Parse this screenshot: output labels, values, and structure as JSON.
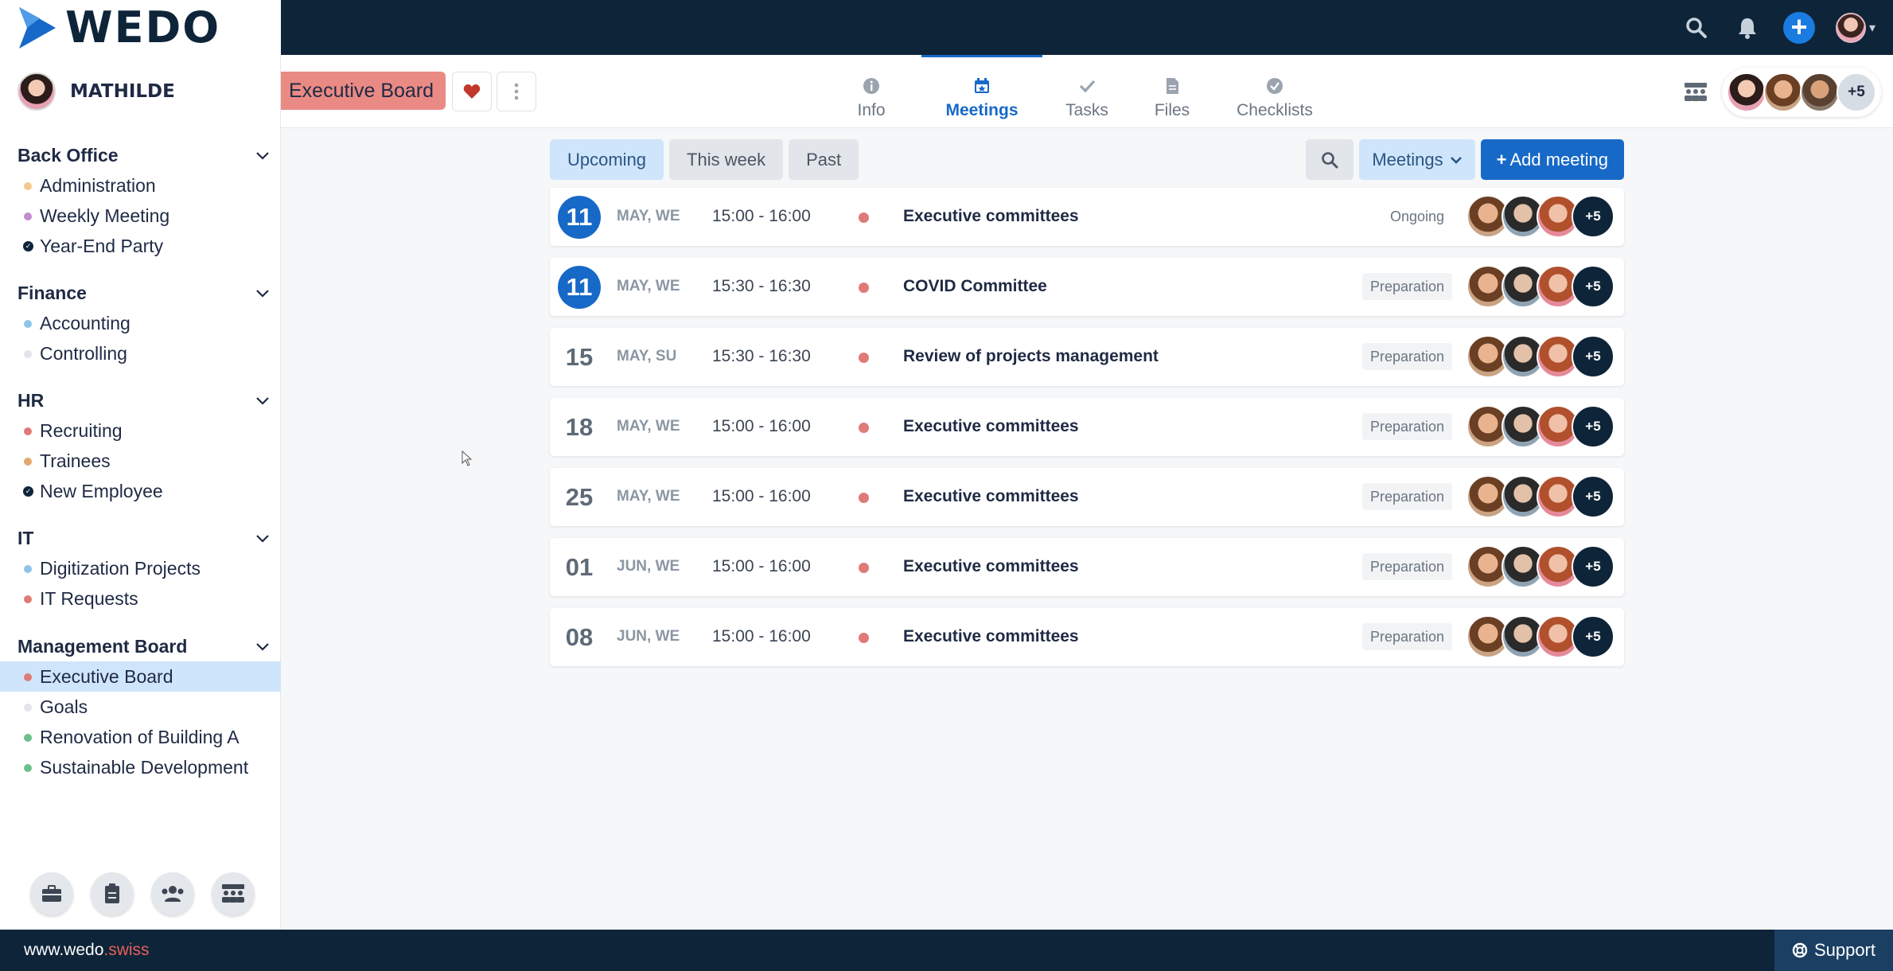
{
  "brand": {
    "name": "WEDO"
  },
  "user": {
    "name": "MATHILDE"
  },
  "sidebar": {
    "groups": [
      {
        "title": "Back Office",
        "items": [
          {
            "label": "Administration",
            "color": "#f3c98b",
            "marker": "dot"
          },
          {
            "label": "Weekly Meeting",
            "color": "#c48ccf",
            "marker": "dot"
          },
          {
            "label": "Year-End Party",
            "color": "#0e2439",
            "marker": "check"
          }
        ]
      },
      {
        "title": "Finance",
        "items": [
          {
            "label": "Accounting",
            "color": "#8ec4ea",
            "marker": "dot"
          },
          {
            "label": "Controlling",
            "color": "#e2e5e9",
            "marker": "dot"
          }
        ]
      },
      {
        "title": "HR",
        "items": [
          {
            "label": "Recruiting",
            "color": "#e07a78",
            "marker": "dot"
          },
          {
            "label": "Trainees",
            "color": "#e2a86c",
            "marker": "dot"
          },
          {
            "label": "New Employee",
            "color": "#0e2439",
            "marker": "check"
          }
        ]
      },
      {
        "title": "IT",
        "items": [
          {
            "label": "Digitization Projects",
            "color": "#8ec4ea",
            "marker": "dot"
          },
          {
            "label": "IT Requests",
            "color": "#e07a78",
            "marker": "dot"
          }
        ]
      },
      {
        "title": "Management Board",
        "items": [
          {
            "label": "Executive Board",
            "color": "#e07a78",
            "marker": "dot",
            "active": true
          },
          {
            "label": "Goals",
            "color": "#e2e5e9",
            "marker": "dot"
          },
          {
            "label": "Renovation of Building A",
            "color": "#6cbf8a",
            "marker": "dot"
          },
          {
            "label": "Sustainable Development",
            "color": "#6cbf8a",
            "marker": "dot"
          }
        ]
      }
    ],
    "bottom_icons": [
      "briefcase-icon",
      "clipboard-icon",
      "users-icon",
      "team-icon"
    ]
  },
  "project": {
    "title": "Executive Board",
    "tag_color": "#ea8a84",
    "favorite_color": "#c0392b"
  },
  "tabs": [
    {
      "label": "Info",
      "icon": "info-icon"
    },
    {
      "label": "Meetings",
      "icon": "calendar-icon",
      "active": true
    },
    {
      "label": "Tasks",
      "icon": "check-icon"
    },
    {
      "label": "Files",
      "icon": "file-icon"
    },
    {
      "label": "Checklists",
      "icon": "checklist-icon"
    }
  ],
  "members": {
    "more_label": "+5"
  },
  "filters": [
    {
      "label": "Upcoming",
      "active": true
    },
    {
      "label": "This week"
    },
    {
      "label": "Past"
    }
  ],
  "actions": {
    "dropdown_label": "Meetings",
    "add_label": "Add meeting"
  },
  "meetings": [
    {
      "day": "11",
      "date": "MAY, WE",
      "time": "15:00 - 16:00",
      "title": "Executive committees",
      "status": "Ongoing",
      "today": true,
      "more": "+5"
    },
    {
      "day": "11",
      "date": "MAY, WE",
      "time": "15:30 - 16:30",
      "title": "COVID Committee",
      "status": "Preparation",
      "today": true,
      "more": "+5"
    },
    {
      "day": "15",
      "date": "MAY, SU",
      "time": "15:30 - 16:30",
      "title": "Review of projects management",
      "status": "Preparation",
      "today": false,
      "more": "+5"
    },
    {
      "day": "18",
      "date": "MAY, WE",
      "time": "15:00 - 16:00",
      "title": "Executive committees",
      "status": "Preparation",
      "today": false,
      "more": "+5"
    },
    {
      "day": "25",
      "date": "MAY, WE",
      "time": "15:00 - 16:00",
      "title": "Executive committees",
      "status": "Preparation",
      "today": false,
      "more": "+5"
    },
    {
      "day": "01",
      "date": "JUN, WE",
      "time": "15:00 - 16:00",
      "title": "Executive committees",
      "status": "Preparation",
      "today": false,
      "more": "+5"
    },
    {
      "day": "08",
      "date": "JUN, WE",
      "time": "15:00 - 16:00",
      "title": "Executive committees",
      "status": "Preparation",
      "today": false,
      "more": "+5"
    }
  ],
  "footer": {
    "url_prefix": "www.wedo",
    "url_suffix": ".swiss",
    "support_label": "Support"
  }
}
